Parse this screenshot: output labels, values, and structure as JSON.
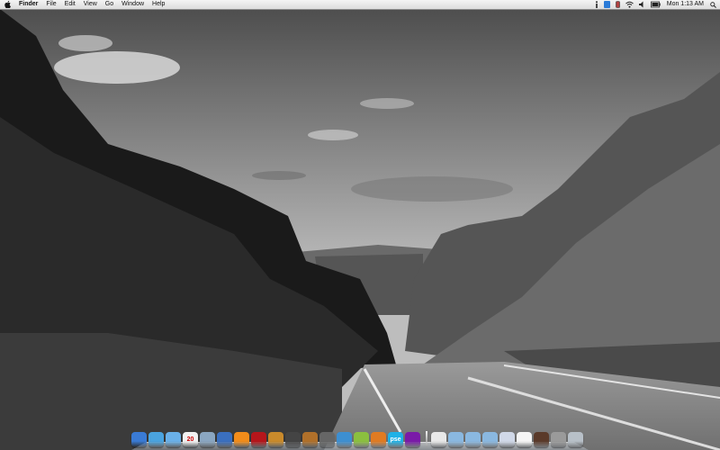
{
  "menubar": {
    "apple_icon": "apple-icon",
    "items": [
      {
        "label": "Finder",
        "app": true
      },
      {
        "label": "File"
      },
      {
        "label": "Edit"
      },
      {
        "label": "View"
      },
      {
        "label": "Go"
      },
      {
        "label": "Window"
      },
      {
        "label": "Help"
      }
    ],
    "status_icons": [
      "info-icon",
      "dropbox-icon",
      "battery-monitor-icon",
      "wifi-icon",
      "volume-icon",
      "battery-icon"
    ],
    "clock": "Mon 1:13 AM",
    "spotlight_icon": "spotlight-icon"
  },
  "dock": {
    "apps": [
      {
        "name": "finder-icon",
        "color": "#3a7bd5"
      },
      {
        "name": "safari-icon",
        "color": "#4aa3df"
      },
      {
        "name": "ichat-icon",
        "color": "#6ab0e8"
      },
      {
        "name": "ical-icon",
        "color": "#f2f2f2",
        "text": "20"
      },
      {
        "name": "preview-icon",
        "color": "#8aa6c1"
      },
      {
        "name": "itunes-icon",
        "color": "#3a6fbf"
      },
      {
        "name": "vlc-icon",
        "color": "#f28c1a"
      },
      {
        "name": "photobooth-icon",
        "color": "#b5161b"
      },
      {
        "name": "iphoto-icon",
        "color": "#c98a2b"
      },
      {
        "name": "instruments-icon",
        "color": "#444444"
      },
      {
        "name": "garageband-icon",
        "color": "#b0702a"
      },
      {
        "name": "scanner-icon",
        "color": "#666666"
      },
      {
        "name": "network-icon",
        "color": "#3d8fd1"
      },
      {
        "name": "pinwheel-icon",
        "color": "#8bbf3f"
      },
      {
        "name": "rss-icon",
        "color": "#e07b22"
      },
      {
        "name": "photoshop-elements-icon",
        "color": "#1fb1e6",
        "text": "pse"
      },
      {
        "name": "frontrow-icon",
        "color": "#7a1aa8"
      }
    ],
    "stacks": [
      {
        "name": "home-folder-icon",
        "color": "#e8e8e8"
      },
      {
        "name": "applications-folder-icon",
        "color": "#8ab8e0"
      },
      {
        "name": "documents-folder-icon",
        "color": "#8ab8e0"
      },
      {
        "name": "downloads-folder-icon",
        "color": "#8ab8e0"
      },
      {
        "name": "mail-icon",
        "color": "#d0d8e8"
      },
      {
        "name": "textedit-icon",
        "color": "#f5f5f5"
      },
      {
        "name": "photo-stack-icon",
        "color": "#5a3a2a"
      },
      {
        "name": "printer-icon",
        "color": "#9a9a9a"
      },
      {
        "name": "trash-icon",
        "color": "#b8c0c8"
      }
    ]
  }
}
